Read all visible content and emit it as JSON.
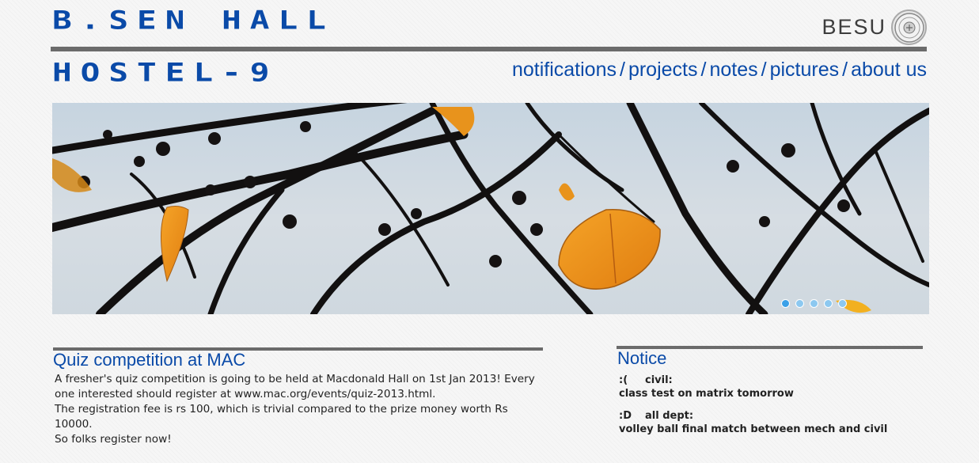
{
  "header": {
    "title_line1": "B.SEN HALL",
    "title_line2": "HOSTEL-9",
    "logo_text": "BESU"
  },
  "nav": {
    "items": [
      "notifications",
      "projects",
      "notes",
      "pictures",
      "about us"
    ],
    "separator": "/"
  },
  "slideshow": {
    "slide_count": 5,
    "active_index": 0
  },
  "article": {
    "title": "Quiz competition at MAC",
    "paragraph1": "A fresher's quiz competition is going to be held at Macdonald Hall on 1st Jan 2013! Every one interested should register at www.mac.org/events/quiz-2013.html.",
    "paragraph2": "The registration fee is rs 100, which is trivial compared to the prize money worth Rs 10000.",
    "paragraph3": "So folks register now!"
  },
  "notice": {
    "title": "Notice",
    "items": [
      {
        "face": ":(",
        "dept": "civil:",
        "text": "class test on matrix tomorrow"
      },
      {
        "face": ":D",
        "dept": "all dept:",
        "text": "volley ball final match between mech and civil"
      }
    ]
  },
  "colors": {
    "accent": "#0a4aa8",
    "rule": "#6b6b6b",
    "background": "#f6f6f6"
  }
}
